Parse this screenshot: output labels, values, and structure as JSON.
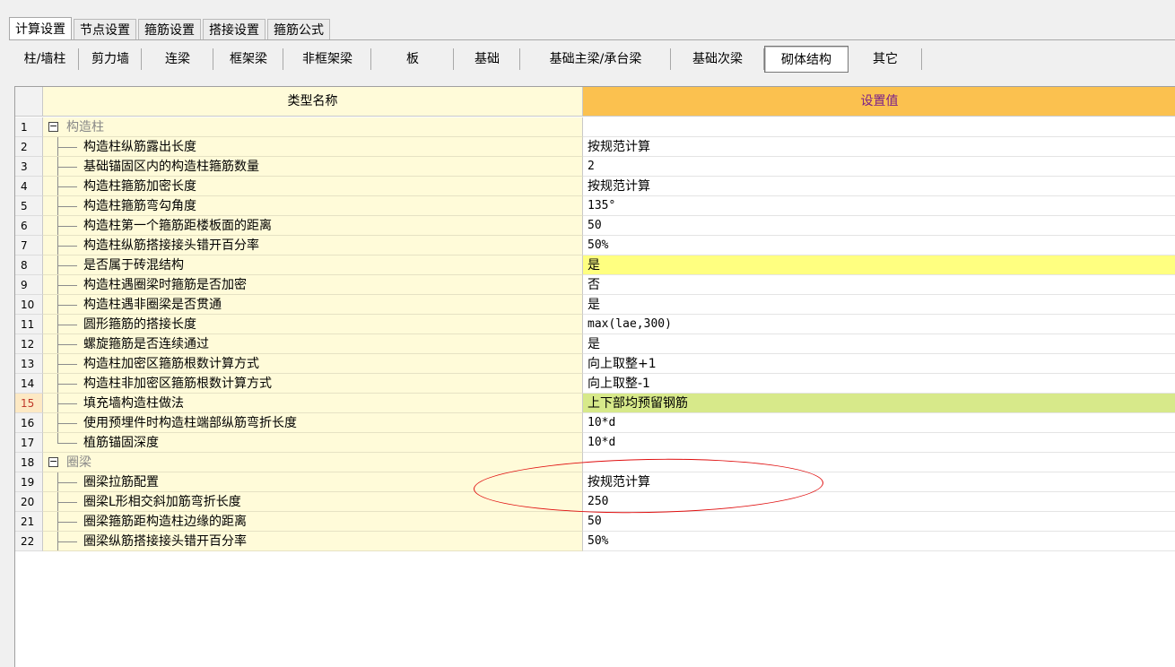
{
  "top_tabs": [
    "计算设置",
    "节点设置",
    "箍筋设置",
    "搭接设置",
    "箍筋公式"
  ],
  "sub_tabs": [
    "柱/墙柱",
    "剪力墙",
    "连梁",
    "框架梁",
    "非框架梁",
    "板",
    "基础",
    "基础主梁/承台梁",
    "基础次梁",
    "砌体结构",
    "其它"
  ],
  "active_sub_tab": "砌体结构",
  "grid": {
    "header_name": "类型名称",
    "header_value": "设置值",
    "rows": [
      {
        "num": "1",
        "name": "构造柱",
        "value": "",
        "group": true
      },
      {
        "num": "2",
        "name": "构造柱纵筋露出长度",
        "value": "按规范计算"
      },
      {
        "num": "3",
        "name": "基础锚固区内的构造柱箍筋数量",
        "value": "2"
      },
      {
        "num": "4",
        "name": "构造柱箍筋加密长度",
        "value": "按规范计算"
      },
      {
        "num": "5",
        "name": "构造柱箍筋弯勾角度",
        "value": "135°"
      },
      {
        "num": "6",
        "name": "构造柱第一个箍筋距楼板面的距离",
        "value": "50"
      },
      {
        "num": "7",
        "name": "构造柱纵筋搭接接头错开百分率",
        "value": "50%"
      },
      {
        "num": "8",
        "name": "是否属于砖混结构",
        "value": "是",
        "highlight": "yellow"
      },
      {
        "num": "9",
        "name": "构造柱遇圈梁时箍筋是否加密",
        "value": "否"
      },
      {
        "num": "10",
        "name": "构造柱遇非圈梁是否贯通",
        "value": "是"
      },
      {
        "num": "11",
        "name": "圆形箍筋的搭接长度",
        "value": "max(lae,300)"
      },
      {
        "num": "12",
        "name": "螺旋箍筋是否连续通过",
        "value": "是"
      },
      {
        "num": "13",
        "name": "构造柱加密区箍筋根数计算方式",
        "value": "向上取整+1"
      },
      {
        "num": "14",
        "name": "构造柱非加密区箍筋根数计算方式",
        "value": "向上取整-1"
      },
      {
        "num": "15",
        "name": "填充墙构造柱做法",
        "value": "上下部均预留钢筋",
        "highlight": "green",
        "selected": true
      },
      {
        "num": "16",
        "name": "使用预埋件时构造柱端部纵筋弯折长度",
        "value": "10*d"
      },
      {
        "num": "17",
        "name": "植筋锚固深度",
        "value": "10*d",
        "last": true
      },
      {
        "num": "18",
        "name": "圈梁",
        "value": "",
        "group": true
      },
      {
        "num": "19",
        "name": "圈梁拉筋配置",
        "value": "按规范计算"
      },
      {
        "num": "20",
        "name": "圈梁L形相交斜加筋弯折长度",
        "value": "250"
      },
      {
        "num": "21",
        "name": "圈梁箍筋距构造柱边缘的距离",
        "value": "50"
      },
      {
        "num": "22",
        "name": "圈梁纵筋搭接接头错开百分率",
        "value": "50%"
      }
    ]
  },
  "colors": {
    "name_column_bg": "#fffbd9",
    "value_header_bg": "#fbc14f",
    "highlight_yellow": "#ffff80",
    "highlight_green": "#d7e98a",
    "annotation_ellipse": "#e01010"
  }
}
